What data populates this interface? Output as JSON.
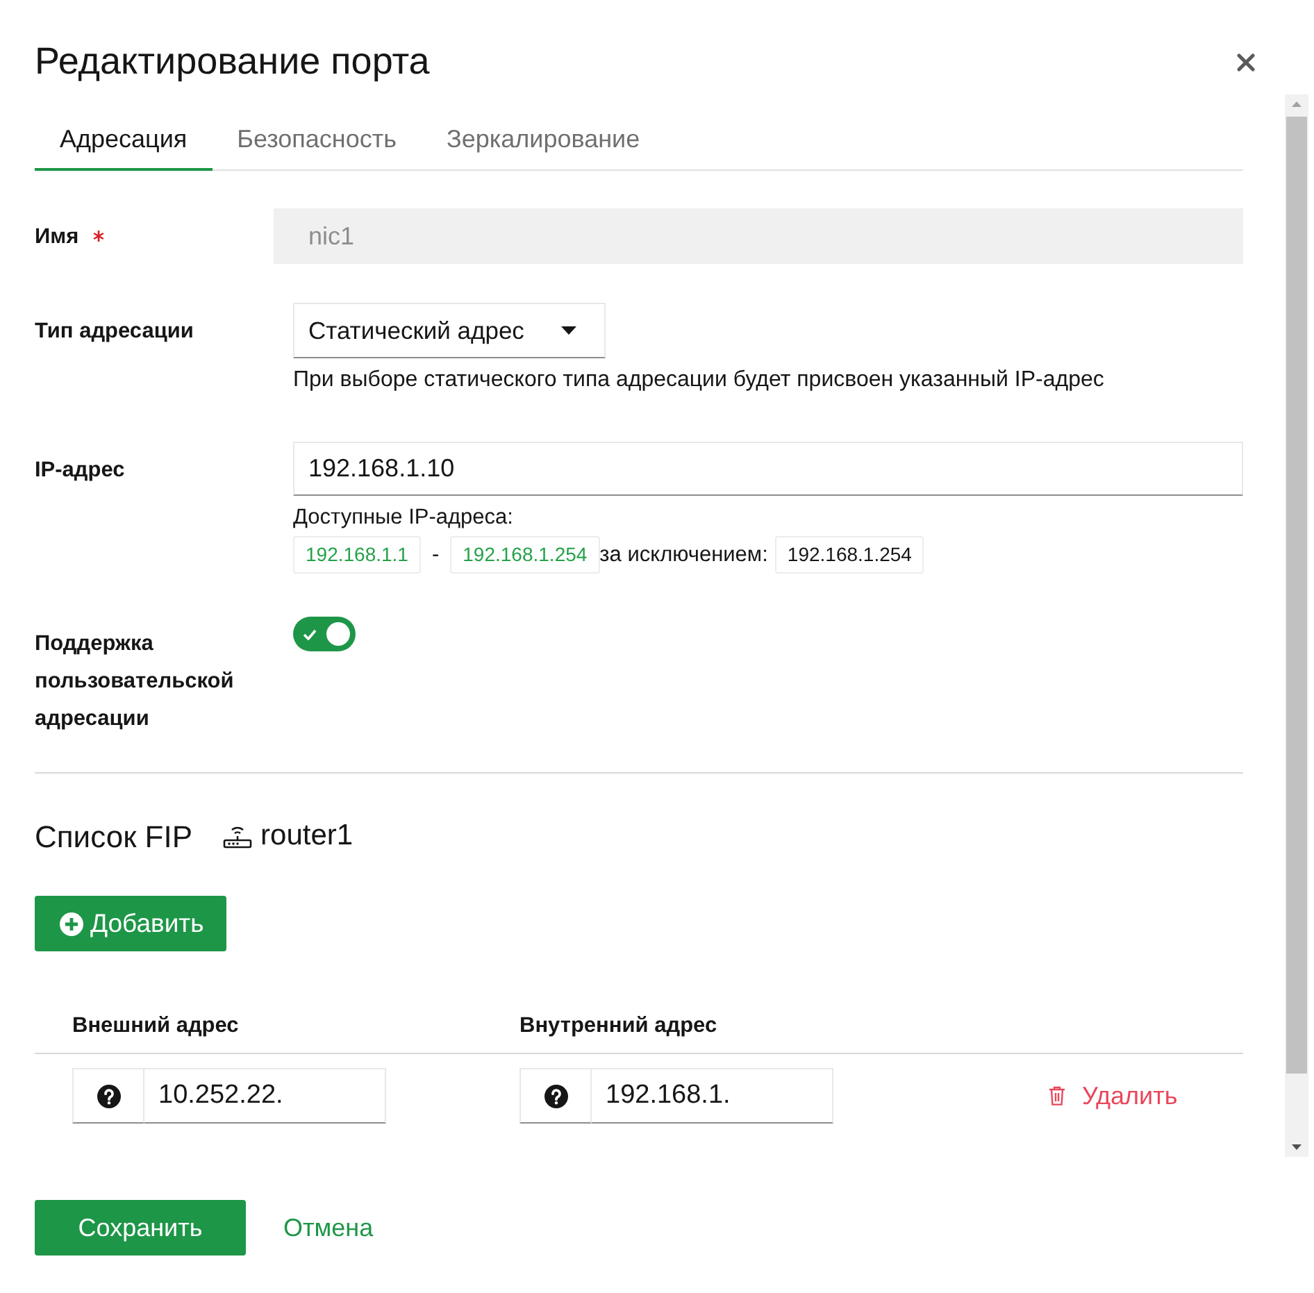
{
  "dialog": {
    "title": "Редактирование порта"
  },
  "tabs": [
    {
      "label": "Адресация",
      "selected": true
    },
    {
      "label": "Безопасность",
      "selected": false
    },
    {
      "label": "Зеркалирование",
      "selected": false
    }
  ],
  "fields": [
    {
      "kind": "text",
      "label": "Имя",
      "required": true,
      "disabled": true,
      "value": "nic1"
    },
    {
      "kind": "select",
      "label": "Тип адресации",
      "required": false,
      "disabled": false,
      "value": "Статический адрес",
      "hint": "При выборе статического типа адресации будет присвоен указанный IP-адрес"
    },
    {
      "kind": "ip",
      "label": "IP-адрес",
      "required": false,
      "disabled": false,
      "value": "192.168.1.10",
      "available_label": "Доступные IP-адреса:",
      "range_start": "192.168.1.1",
      "range_separator": "-",
      "range_end": "192.168.1.254",
      "except_label": "за исключением:",
      "excluded": [
        "192.168.1.254"
      ]
    },
    {
      "kind": "toggle",
      "label": "Поддержка пользовательской адресации",
      "required": false,
      "disabled": false,
      "on": true
    }
  ],
  "fip": {
    "title": "Список FIP",
    "router": "router1",
    "add_button": "Добавить",
    "columns": [
      "Внешний адрес",
      "Внутренний адрес"
    ],
    "rows": [
      {
        "external": "10.252.22.",
        "internal": "192.168.1.",
        "delete_label": "Удалить"
      }
    ]
  },
  "footer": {
    "save_button": "Сохранить",
    "cancel_link": "Отмена"
  }
}
